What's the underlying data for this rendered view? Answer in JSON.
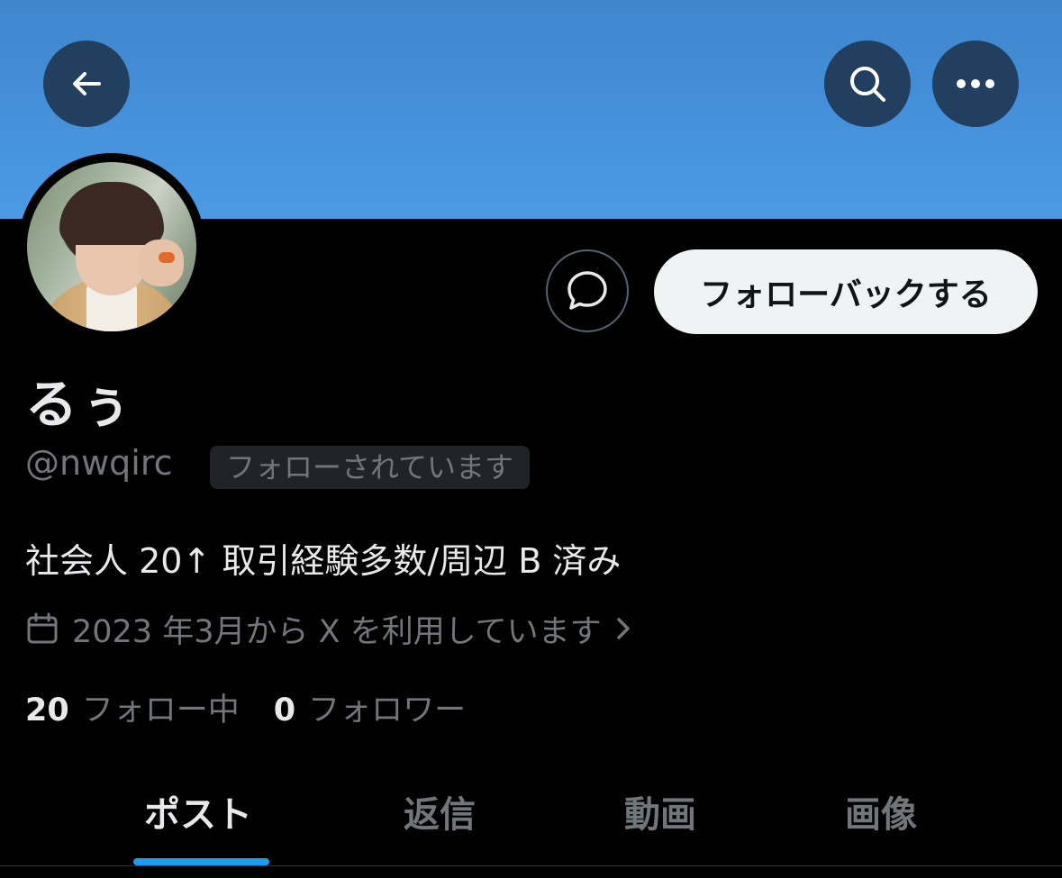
{
  "header": {
    "back_icon": "arrow-left-icon",
    "search_icon": "search-icon",
    "more_icon": "more-horizontal-icon",
    "banner_color": "#4a9ae6"
  },
  "profile": {
    "display_name": "るぅ",
    "handle": "@nwqirc",
    "follows_you_badge": "フォローされています",
    "bio": "社会人 20↑ 取引経験多数/周辺 B 済み",
    "joined": "2023 年3月から X を利用しています",
    "avatar": "profile-photo"
  },
  "actions": {
    "message_icon": "message-bubble-icon",
    "follow_back_label": "フォローバックする"
  },
  "stats": {
    "following_count": "20",
    "following_label": "フォロー中",
    "followers_count": "0",
    "followers_label": "フォロワー"
  },
  "tabs": [
    {
      "label": "ポスト",
      "active": true
    },
    {
      "label": "返信",
      "active": false
    },
    {
      "label": "動画",
      "active": false
    },
    {
      "label": "画像",
      "active": false
    }
  ],
  "colors": {
    "accent": "#1d9bf0",
    "background": "#000000",
    "secondary_text": "#71767b"
  }
}
